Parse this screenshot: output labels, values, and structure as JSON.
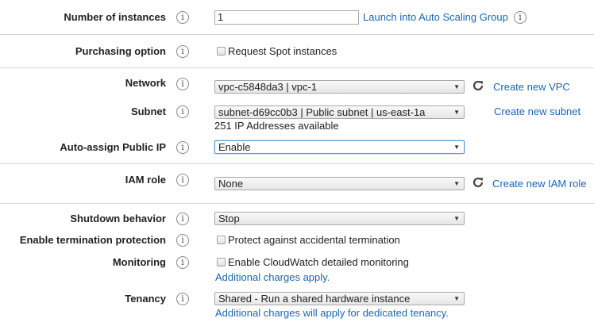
{
  "instances": {
    "label": "Number of instances",
    "value": "1",
    "link": "Launch into Auto Scaling Group"
  },
  "purchasing": {
    "label": "Purchasing option",
    "checkbox_label": "Request Spot instances",
    "checked": false
  },
  "network": {
    "label": "Network",
    "selected": "vpc-c5848da3 | vpc-1",
    "create_link": "Create new VPC"
  },
  "subnet": {
    "label": "Subnet",
    "selected": "subnet-d69cc0b3 | Public subnet | us-east-1a",
    "create_link": "Create new subnet",
    "available": "251 IP Addresses available"
  },
  "public_ip": {
    "label": "Auto-assign Public IP",
    "selected": "Enable"
  },
  "iam": {
    "label": "IAM role",
    "selected": "None",
    "create_link": "Create new IAM role"
  },
  "shutdown": {
    "label": "Shutdown behavior",
    "selected": "Stop"
  },
  "termination": {
    "label": "Enable termination protection",
    "checkbox_label": "Protect against accidental termination",
    "checked": false
  },
  "monitoring": {
    "label": "Monitoring",
    "checkbox_label": "Enable CloudWatch detailed monitoring",
    "checked": false,
    "note_link": "Additional charges apply."
  },
  "tenancy": {
    "label": "Tenancy",
    "selected": "Shared - Run a shared hardware instance",
    "note_link": "Additional charges will apply for dedicated tenancy."
  },
  "icons": {
    "info": "info-icon",
    "refresh": "refresh-icon",
    "caret": "chevron-down-icon"
  },
  "colors": {
    "link": "#1a66b3",
    "divider": "#d5d5d5",
    "focus": "#5b9dd9"
  }
}
